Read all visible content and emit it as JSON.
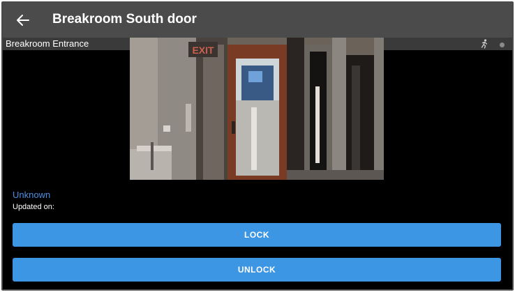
{
  "header": {
    "title": "Breakroom South door",
    "back_icon": "arrow-left-icon"
  },
  "camera": {
    "name": "Breakroom Entrance",
    "motion_icon": "running-person-icon",
    "status_icon": "status-dot-icon",
    "exit_sign_text": "EXIT"
  },
  "door": {
    "state": "Unknown",
    "updated_label": "Updated on:"
  },
  "actions": {
    "lock_label": "LOCK",
    "unlock_label": "UNLOCK"
  },
  "colors": {
    "appbar": "#4b4b4b",
    "accent_button": "#3d96e4",
    "state_text": "#4a90e2",
    "background": "#000000"
  }
}
